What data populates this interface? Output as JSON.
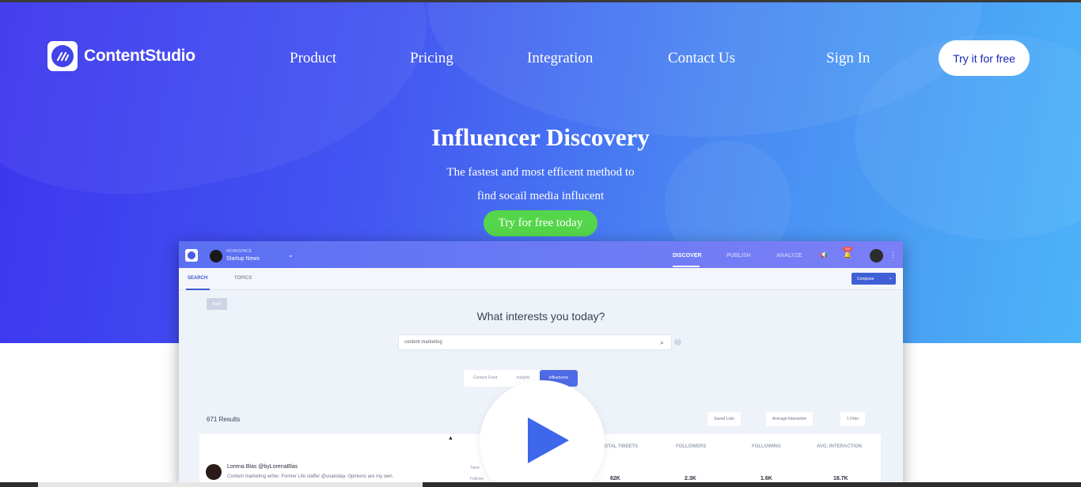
{
  "brand": {
    "name": "ContentStudio"
  },
  "nav": {
    "product": "Product",
    "pricing": "Pricing",
    "integration": "Integration",
    "contact": "Contact Us",
    "signin": "Sign In"
  },
  "header_cta": "Try it for free",
  "hero": {
    "title": "Influencer Discovery",
    "subtitle_line1": "The fastest and most efficent method to",
    "subtitle_line2": "find socail media influcent",
    "cta": "Try for free today"
  },
  "colors": {
    "hero_gradient_start": "#3c35ef",
    "hero_gradient_end": "#4bb4f8",
    "cta_green": "#54d64a",
    "play_blue": "#3f67eb"
  },
  "app": {
    "workspace_label": "WORKSPACE",
    "workspace_name": "Startup News",
    "tabs": [
      "DISCOVER",
      "PUBLISH",
      "ANALYZE"
    ],
    "notification_count": "209",
    "subtabs": [
      "SEARCH",
      "TOPICS"
    ],
    "compose": "Compose",
    "back": "Back",
    "question": "What interests you today?",
    "search_value": "content marketing",
    "modes": [
      "Content Feed",
      "Insights",
      "Influencers"
    ],
    "results": "671 Results",
    "filters": [
      "Saved Lists",
      "Average Interaction",
      "1 Filter"
    ],
    "columns": [
      "TOTAL TWEETS",
      "FOLLOWERS",
      "FOLLOWING",
      "AVG. INTERACTION"
    ],
    "row": {
      "name": "Lorena Blas @byLorenaBlas",
      "desc": "Content marketing writer. Former Life staffer @usatoday. Opinions are my own.",
      "link1": "Twee",
      "link2": "Followe",
      "tweets": "62K",
      "followers": "2.3K",
      "following": "1.6K",
      "interaction": "18.7K"
    }
  },
  "icons": [
    "logo-icon",
    "play-icon",
    "search-icon",
    "bell-icon",
    "megaphone-icon",
    "help-icon"
  ]
}
